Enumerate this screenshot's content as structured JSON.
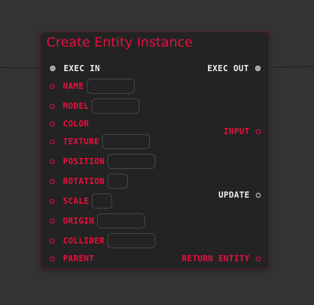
{
  "node": {
    "title": "Create Entity Instance",
    "accent_color": "#e8103f",
    "background_color": "#232323",
    "border_color": "#6b1b2c"
  },
  "inputs": {
    "exec_in": "EXEC IN",
    "name": {
      "label": "NAME",
      "value": ""
    },
    "model": {
      "label": "MODEL",
      "value": ""
    },
    "color": {
      "label": "COLOR"
    },
    "texture": {
      "label": "TEXTURE",
      "value": ""
    },
    "position": {
      "label": "POSITION",
      "value": ""
    },
    "rotation": {
      "label": "ROTATION",
      "value": ""
    },
    "scale": {
      "label": "SCALE",
      "value": ""
    },
    "origin": {
      "label": "ORIGIN",
      "value": ""
    },
    "collider": {
      "label": "COLLIDER",
      "value": ""
    },
    "parent": {
      "label": "PARENT"
    }
  },
  "outputs": {
    "exec_out": "EXEC OUT",
    "input": "INPUT",
    "update": "UPDATE",
    "return_entity": "RETURN ENTITY"
  }
}
